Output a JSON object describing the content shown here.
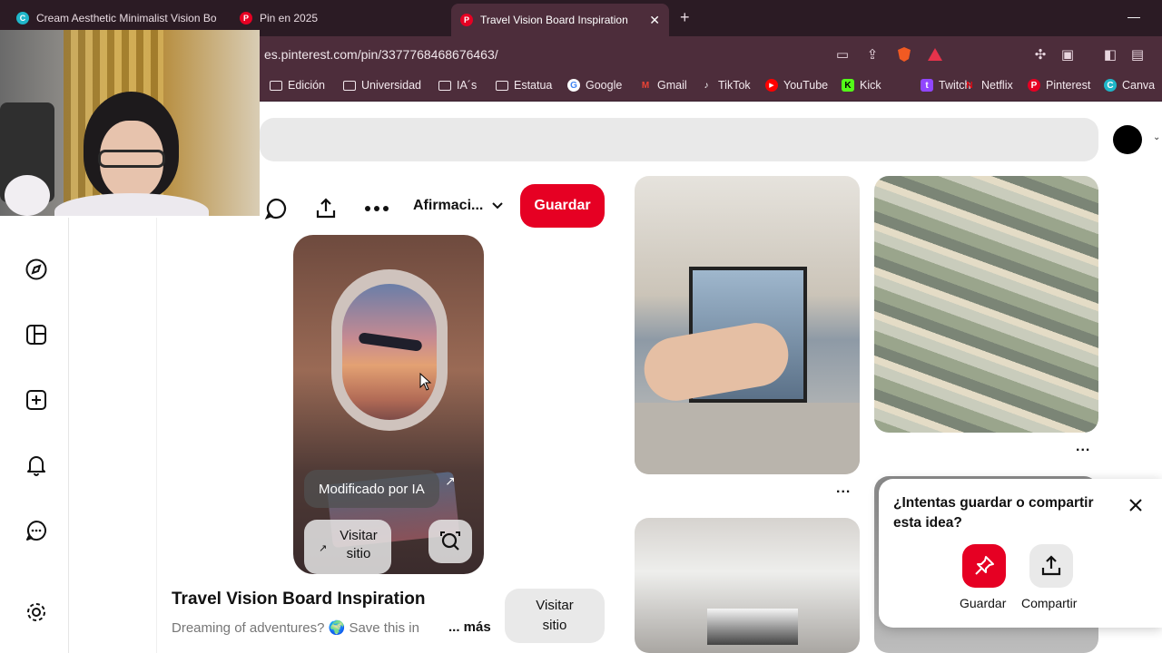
{
  "browser": {
    "tabs": [
      {
        "title": "Cream Aesthetic Minimalist Vision Bo",
        "favicon": "canva-icon"
      },
      {
        "title": "Pin en 2025",
        "favicon": "pinterest-icon"
      },
      {
        "title": "Travel Vision Board Inspiration",
        "favicon": "pinterest-icon"
      }
    ],
    "new_tab": "+",
    "url": "es.pinterest.com/pin/3377768468676463/",
    "bookmarks": [
      {
        "label": "Edición",
        "icon": "folder-icon"
      },
      {
        "label": "Universidad",
        "icon": "folder-icon"
      },
      {
        "label": "IA´s",
        "icon": "folder-icon"
      },
      {
        "label": "Estatua",
        "icon": "folder-icon"
      },
      {
        "label": "Google",
        "icon": "google-icon"
      },
      {
        "label": "Gmail",
        "icon": "gmail-icon"
      },
      {
        "label": "TikTok",
        "icon": "tiktok-icon"
      },
      {
        "label": "YouTube",
        "icon": "youtube-icon"
      },
      {
        "label": "Kick",
        "icon": "kick-icon"
      },
      {
        "label": "Twitch",
        "icon": "twitch-icon"
      },
      {
        "label": "Netflix",
        "icon": "netflix-icon"
      },
      {
        "label": "Pinterest",
        "icon": "pinterest-icon"
      },
      {
        "label": "Canva",
        "icon": "canva-icon"
      }
    ]
  },
  "pin": {
    "board_select": "Afirmaci...",
    "save_label": "Guardar",
    "ai_badge": "Modificado por IA",
    "visit_overlay": "Visitar sitio",
    "title": "Travel Vision Board Inspiration",
    "description": "Dreaming of adventures? 🌍 Save this in",
    "more": "... más",
    "visit_button": "Visitar sitio"
  },
  "grid": {
    "more_dots": "..."
  },
  "popup": {
    "title": "¿Intentas guardar o compartir esta idea?",
    "save_label": "Guardar",
    "share_label": "Compartir"
  },
  "colors": {
    "pinterest_red": "#e60023",
    "browser_chrome": "#4d2d3b",
    "tabbar": "#2b1b24"
  }
}
